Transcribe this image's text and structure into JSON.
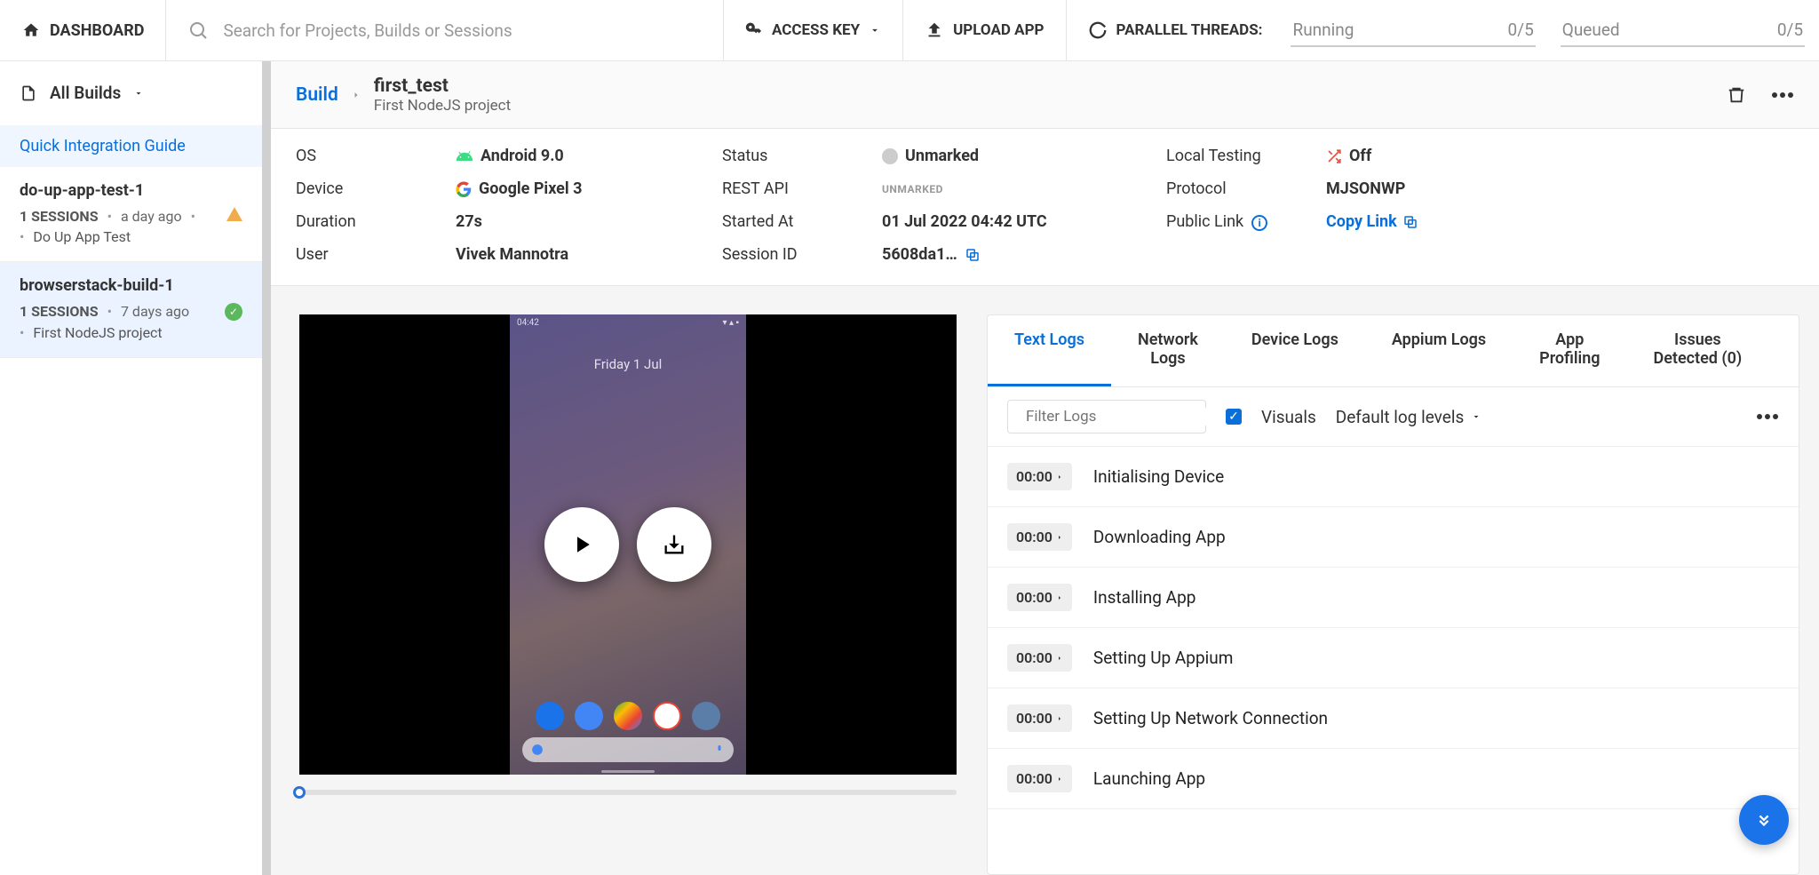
{
  "topbar": {
    "dashboard": "DASHBOARD",
    "search_placeholder": "Search for Projects, Builds or Sessions",
    "access_key": "ACCESS KEY",
    "upload": "UPLOAD APP",
    "parallel": "PARALLEL THREADS:",
    "meters": [
      {
        "label": "Running",
        "value": "0/5"
      },
      {
        "label": "Queued",
        "value": "0/5"
      }
    ]
  },
  "sidebar": {
    "header_label": "All Builds",
    "quick_guide": "Quick Integration Guide",
    "builds": [
      {
        "title": "do-up-app-test-1",
        "sessions": "1 SESSIONS",
        "time": "a day ago",
        "desc": "Do Up App Test",
        "status": "warn"
      },
      {
        "title": "browserstack-build-1",
        "sessions": "1 SESSIONS",
        "time": "7 days ago",
        "desc": "First NodeJS project",
        "status": "pass"
      }
    ]
  },
  "header": {
    "crumb": "Build",
    "title": "first_test",
    "subtitle": "First NodeJS project"
  },
  "info": {
    "os_label": "OS",
    "os_value": "Android 9.0",
    "device_label": "Device",
    "device_value": "Google Pixel 3",
    "duration_label": "Duration",
    "duration_value": "27s",
    "user_label": "User",
    "user_value": "Vivek Mannotra",
    "status_label": "Status",
    "status_value": "Unmarked",
    "restapi_label": "REST API",
    "restapi_value": "UNMARKED",
    "started_label": "Started At",
    "started_value": "01 Jul 2022 04:42 UTC",
    "sessionid_label": "Session ID",
    "sessionid_value": "5608da1…",
    "localtest_label": "Local Testing",
    "localtest_value": "Off",
    "protocol_label": "Protocol",
    "protocol_value": "MJSONWP",
    "publiclink_label": "Public Link",
    "copy_link": "Copy Link"
  },
  "phone": {
    "time": "04:42",
    "date": "Friday 1 Jul"
  },
  "tabs": [
    {
      "label": "Text Logs"
    },
    {
      "label": "Network Logs"
    },
    {
      "label": "Device Logs"
    },
    {
      "label": "Appium Logs"
    },
    {
      "label": "App Profiling"
    },
    {
      "label": "Issues Detected (0)"
    }
  ],
  "log_tools": {
    "filter_placeholder": "Filter Logs",
    "visuals_label": "Visuals",
    "levels_label": "Default log levels"
  },
  "logs": [
    {
      "ts": "00:00",
      "msg": "Initialising Device"
    },
    {
      "ts": "00:00",
      "msg": "Downloading App"
    },
    {
      "ts": "00:00",
      "msg": "Installing App"
    },
    {
      "ts": "00:00",
      "msg": "Setting Up Appium"
    },
    {
      "ts": "00:00",
      "msg": "Setting Up Network Connection"
    },
    {
      "ts": "00:00",
      "msg": "Launching App"
    }
  ]
}
